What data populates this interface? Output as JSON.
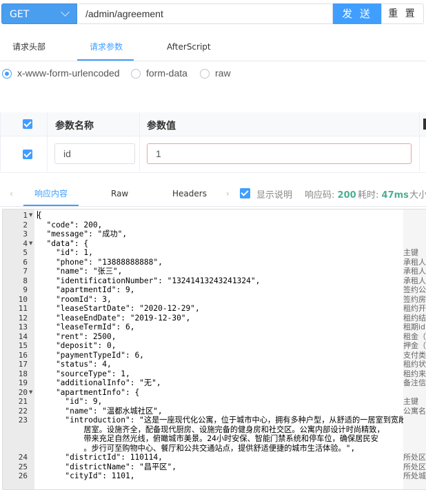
{
  "request": {
    "method": "GET",
    "url": "/admin/agreement",
    "send_label": "发 送",
    "reset_label": "重 置"
  },
  "request_tabs": [
    {
      "label": "请求头部",
      "active": false
    },
    {
      "label": "请求参数",
      "active": true
    },
    {
      "label": "AfterScript",
      "active": false
    }
  ],
  "body_types": [
    {
      "label": "x-www-form-urlencoded",
      "selected": true
    },
    {
      "label": "form-data",
      "selected": false
    },
    {
      "label": "raw",
      "selected": false
    }
  ],
  "params_table": {
    "headers": [
      "参数名称",
      "参数值"
    ],
    "rows": [
      {
        "checked": true,
        "name": "id",
        "value": "1"
      }
    ]
  },
  "response": {
    "tabs": [
      {
        "label": "响应内容",
        "active": true
      },
      {
        "label": "Raw",
        "active": false
      },
      {
        "label": "Headers",
        "active": false
      }
    ],
    "show_desc_label": "显示说明",
    "status_label": "响应码:",
    "status_value": "200",
    "time_label": "耗时:",
    "time_value": "47ms",
    "size_label": "大小"
  },
  "code_lines": [
    {
      "n": "1",
      "fold": true,
      "t": "{"
    },
    {
      "n": "2",
      "t": "  \"code\": 200,"
    },
    {
      "n": "3",
      "t": "  \"message\": \"成功\","
    },
    {
      "n": "4",
      "fold": true,
      "t": "  \"data\": {"
    },
    {
      "n": "5",
      "t": "    \"id\": 1,"
    },
    {
      "n": "6",
      "t": "    \"phone\": \"13888888888\","
    },
    {
      "n": "7",
      "t": "    \"name\": \"张三\","
    },
    {
      "n": "8",
      "t": "    \"identificationNumber\": \"13241413243241324\","
    },
    {
      "n": "9",
      "t": "    \"apartmentId\": 9,"
    },
    {
      "n": "10",
      "t": "    \"roomId\": 3,"
    },
    {
      "n": "11",
      "t": "    \"leaseStartDate\": \"2020-12-29\","
    },
    {
      "n": "12",
      "t": "    \"leaseEndDate\": \"2019-12-30\","
    },
    {
      "n": "13",
      "t": "    \"leaseTermId\": 6,"
    },
    {
      "n": "14",
      "t": "    \"rent\": 2500,"
    },
    {
      "n": "15",
      "t": "    \"deposit\": 0,"
    },
    {
      "n": "16",
      "t": "    \"paymentTypeId\": 6,"
    },
    {
      "n": "17",
      "t": "    \"status\": 4,"
    },
    {
      "n": "18",
      "t": "    \"sourceType\": 1,"
    },
    {
      "n": "19",
      "t": "    \"additionalInfo\": \"无\","
    },
    {
      "n": "20",
      "fold": true,
      "t": "    \"apartmentInfo\": {"
    },
    {
      "n": "21",
      "t": "      \"id\": 9,"
    },
    {
      "n": "22",
      "t": "      \"name\": \"温都水城社区\","
    },
    {
      "n": "23",
      "t": "      \"introduction\": \"这是一座现代化公寓，位于城市中心，拥有多种户型，从舒适的一居室到宽敞的"
    },
    {
      "n": "",
      "t": "          居室。设施齐全，配备现代厨房、设施完备的健身房和社交区。公寓内部设计时尚精致，"
    },
    {
      "n": "",
      "t": "          带来充足自然光线，俯瞰城市美景。24小时安保、智能门禁系统和停车位，确保居民安"
    },
    {
      "n": "",
      "t": "          。步行可至购物中心、餐厅和公共交通站点，提供舒适便捷的城市生活体验。\","
    },
    {
      "n": "24",
      "t": "      \"districtId\": 110114,"
    },
    {
      "n": "25",
      "t": "      \"districtName\": \"昌平区\","
    },
    {
      "n": "26",
      "t": "      \"cityId\": 1101,"
    }
  ],
  "descriptions": [
    {
      "line": 5,
      "t": "主键"
    },
    {
      "line": 6,
      "t": "承租人"
    },
    {
      "line": 7,
      "t": "承租人"
    },
    {
      "line": 8,
      "t": "承租人"
    },
    {
      "line": 9,
      "t": "签约公"
    },
    {
      "line": 10,
      "t": "签约房"
    },
    {
      "line": 11,
      "t": "租约开"
    },
    {
      "line": 12,
      "t": "租约结"
    },
    {
      "line": 13,
      "t": "租期id"
    },
    {
      "line": 14,
      "t": "租金（"
    },
    {
      "line": 15,
      "t": "押金（"
    },
    {
      "line": 16,
      "t": "支付类"
    },
    {
      "line": 17,
      "t": "租约状"
    },
    {
      "line": 18,
      "t": "租约来"
    },
    {
      "line": 19,
      "t": "备注信"
    },
    {
      "line": 21,
      "t": "主键"
    },
    {
      "line": 22,
      "t": "公寓名"
    },
    {
      "line": 24,
      "t": "所处区"
    },
    {
      "line": 25,
      "t": "所处区"
    },
    {
      "line": 26,
      "t": "所处城"
    }
  ],
  "colors": {
    "accent": "#409eff",
    "method_bg": "#4a9eef",
    "status_ok": "#4caf8f"
  }
}
